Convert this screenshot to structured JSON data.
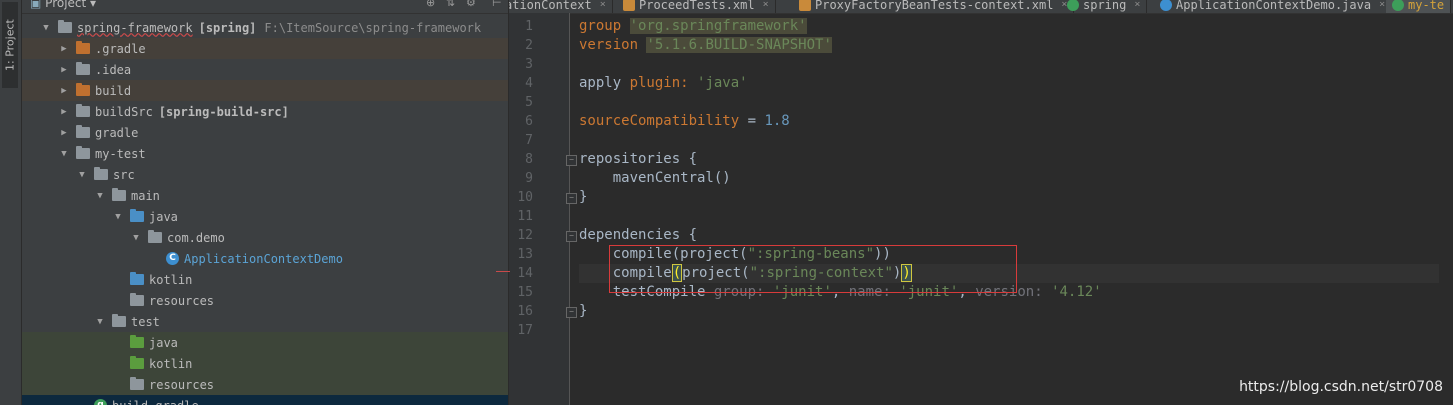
{
  "side_strip": {
    "label": "1: Project"
  },
  "project_panel": {
    "title": "Project",
    "tree": [
      {
        "indent": 0,
        "arrow": "▼",
        "icon": "folder-grey",
        "name": "spring-framework",
        "suffix": "[spring]",
        "path": "F:\\ItemSource\\spring-framework"
      },
      {
        "indent": 1,
        "arrow": "▶",
        "icon": "folder-orange",
        "name": ".gradle"
      },
      {
        "indent": 1,
        "arrow": "▶",
        "icon": "folder-grey",
        "name": ".idea"
      },
      {
        "indent": 1,
        "arrow": "▶",
        "icon": "folder-orange",
        "name": "build"
      },
      {
        "indent": 1,
        "arrow": "▶",
        "icon": "folder-grey",
        "name": "buildSrc",
        "suffix": "[spring-build-src]"
      },
      {
        "indent": 1,
        "arrow": "▶",
        "icon": "folder-grey",
        "name": "gradle"
      },
      {
        "indent": 1,
        "arrow": "▼",
        "icon": "folder-grey",
        "name": "my-test"
      },
      {
        "indent": 2,
        "arrow": "▼",
        "icon": "folder-grey",
        "name": "src"
      },
      {
        "indent": 3,
        "arrow": "▼",
        "icon": "folder-grey",
        "name": "main"
      },
      {
        "indent": 4,
        "arrow": "▼",
        "icon": "folder-blue",
        "name": "java"
      },
      {
        "indent": 5,
        "arrow": "▼",
        "icon": "folder-grey",
        "name": "com.demo"
      },
      {
        "indent": 6,
        "arrow": "",
        "icon": "class",
        "name": "ApplicationContextDemo"
      },
      {
        "indent": 4,
        "arrow": "",
        "icon": "folder-blue",
        "name": "kotlin"
      },
      {
        "indent": 4,
        "arrow": "",
        "icon": "folder-res",
        "name": "resources"
      },
      {
        "indent": 3,
        "arrow": "▼",
        "icon": "folder-grey",
        "name": "test"
      },
      {
        "indent": 4,
        "arrow": "",
        "icon": "folder-green",
        "name": "java"
      },
      {
        "indent": 4,
        "arrow": "",
        "icon": "folder-green",
        "name": "kotlin"
      },
      {
        "indent": 4,
        "arrow": "",
        "icon": "folder-res",
        "name": "resources"
      },
      {
        "indent": 2,
        "arrow": "",
        "icon": "gradle",
        "name": "build.gradle"
      }
    ]
  },
  "editor": {
    "tabs": [
      {
        "label": "ationContext",
        "icon": "xml",
        "active": false
      },
      {
        "label": "ProceedTests.xml",
        "icon": "xml",
        "active": false
      },
      {
        "label": "ProxyFactoryBeanTests-context.xml",
        "icon": "xml",
        "active": false
      },
      {
        "label": "spring",
        "icon": "gradle",
        "active": false
      },
      {
        "label": "ApplicationContextDemo.java",
        "icon": "class",
        "active": false
      },
      {
        "label": "my-te",
        "icon": "gradle",
        "active": true
      }
    ],
    "lines": [
      "1",
      "2",
      "3",
      "4",
      "5",
      "6",
      "7",
      "8",
      "9",
      "10",
      "11",
      "12",
      "13",
      "14",
      "15",
      "16",
      "17"
    ],
    "code": {
      "group_kw": "group",
      "group_val": "'org.springframework'",
      "version_kw": "version",
      "version_val": "'5.1.6.BUILD-SNAPSHOT'",
      "apply": "apply ",
      "plugin": "plugin: ",
      "java": "'java'",
      "src_compat": "sourceCompatibility",
      "eq": " = ",
      "compat_val": "1.8",
      "repositories": "repositories {",
      "maven": "    mavenCentral()",
      "close": "}",
      "dependencies": "dependencies {",
      "dep1_a": "    compile(project(",
      "dep1_str": "\":spring-beans\"",
      "dep1_b": "))",
      "dep2_a": "    compile",
      "dep2_paren": "(",
      "dep2_b": "project(",
      "dep2_str": "\":spring-context\"",
      "dep2_c": ")",
      "dep2_close": ")",
      "dep3_a": "    testCompile ",
      "dep3_group": "group: ",
      "dep3_gval": "'junit'",
      "comma": ", ",
      "dep3_name": "name: ",
      "dep3_nval": "'junit'",
      "dep3_ver": "version: ",
      "dep3_vval": "'4.12'"
    }
  },
  "watermark": "https://blog.csdn.net/str0708"
}
